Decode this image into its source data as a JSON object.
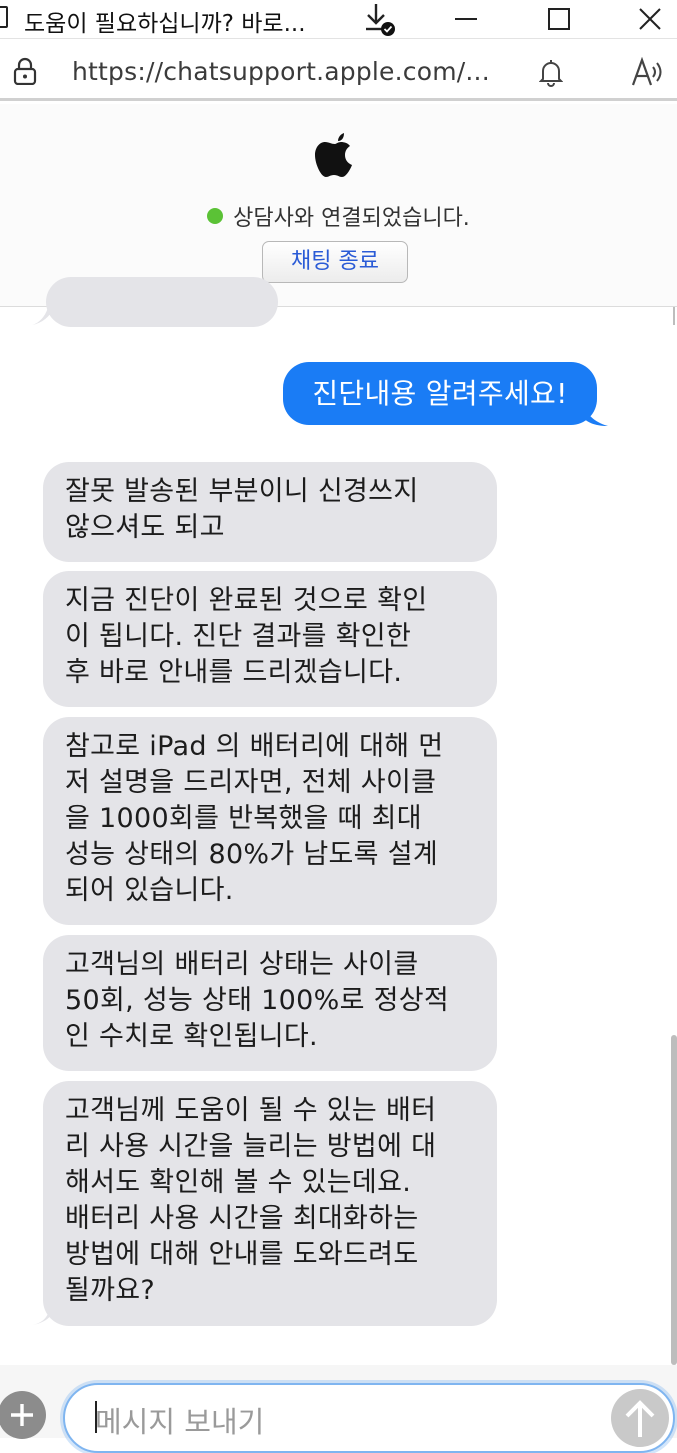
{
  "window": {
    "title": "도움이 필요하십니까? 바로..."
  },
  "address_bar": {
    "url": "https://chatsupport.apple.com/..."
  },
  "chat_header": {
    "status": "상담사와 연결되었습니다.",
    "status_color": "#5bc236",
    "end_chat_label": "채팅 종료"
  },
  "messages": [
    {
      "from": "user",
      "text": "진단내용 알려주세요!"
    },
    {
      "from": "agent",
      "text": "잘못 발송된 부분이니 신경쓰지\n않으셔도 되고"
    },
    {
      "from": "agent",
      "text": "지금 진단이 완료된 것으로 확인\n이 됩니다. 진단 결과를 확인한\n후 바로 안내를 드리겠습니다."
    },
    {
      "from": "agent",
      "text": "참고로 iPad 의 배터리에 대해 먼\n저 설명을 드리자면, 전체 사이클\n을 1000회를 반복했을 때 최대\n성능 상태의 80%가 남도록 설계\n되어 있습니다."
    },
    {
      "from": "agent",
      "text": "고객님의 배터리 상태는 사이클\n50회, 성능 상태 100%로 정상적\n인 수치로 확인됩니다."
    },
    {
      "from": "agent",
      "text": "고객님께 도움이 될 수 있는 배터\n리 사용 시간을 늘리는 방법에 대\n해서도 확인해 볼 수 있는데요.\n배터리 사용 시간을 최대화하는\n방법에 대해 안내를 도와드려도\n될까요?"
    }
  ],
  "composer": {
    "placeholder": "메시지 보내기"
  },
  "colors": {
    "outgoing_bubble": "#1a7cf5",
    "incoming_bubble": "#e4e4e8"
  }
}
